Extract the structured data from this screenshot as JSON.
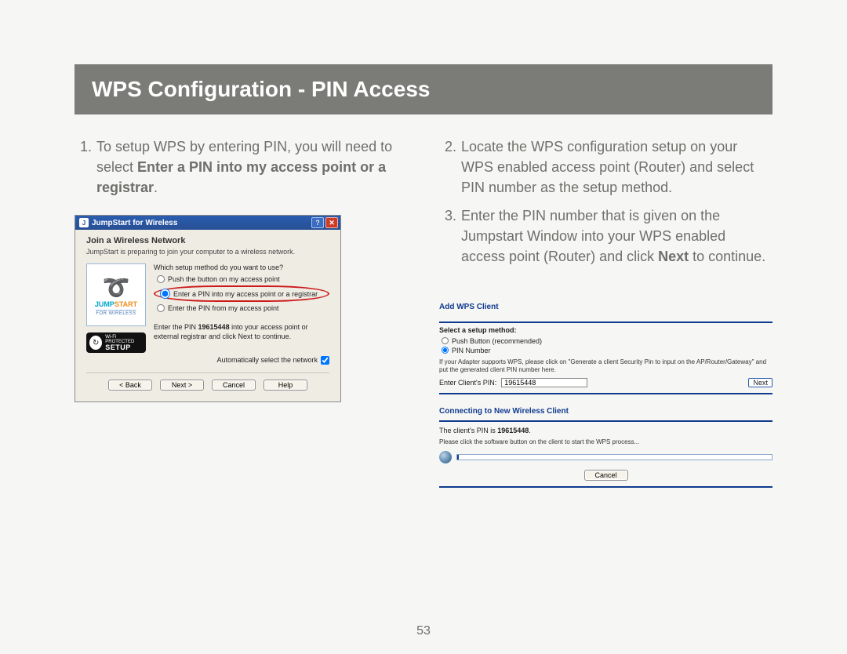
{
  "title": "WPS Configuration - PIN Access",
  "page_number": "53",
  "steps_left": {
    "1": {
      "num": "1.",
      "pre": "To setup WPS by entering PIN, you will need to select ",
      "bold": "Enter a PIN into my access point or a registrar",
      "post": "."
    }
  },
  "steps_right": {
    "2": {
      "num": "2.",
      "text": "Locate the WPS configuration setup on your WPS enabled access point (Router) and select PIN number as the setup method."
    },
    "3": {
      "num": "3.",
      "pre": "Enter the PIN number that is given on the Jumpstart Window into your WPS enabled access point (Router) and click ",
      "bold": "Next",
      "post": " to continue."
    }
  },
  "dialog": {
    "app_icon_glyph": "J",
    "title": "JumpStart for Wireless",
    "help_glyph": "?",
    "close_glyph": "✕",
    "heading": "Join a Wireless Network",
    "subheading": "JumpStart is preparing to join your computer to a wireless network.",
    "logo_word_a": "JUMP",
    "logo_word_b": "START",
    "logo_sub": "FOR WIRELESS",
    "wps_top": "Wi-Fi PROTECTED",
    "wps_setup": "SETUP",
    "question": "Which setup method do you want to use?",
    "opt1": "Push the button on my access point",
    "opt2": "Enter a PIN into my access point or a registrar",
    "opt3": "Enter the PIN from my access point",
    "enter_pin_a": "Enter the PIN ",
    "enter_pin_b": "19615448",
    "enter_pin_c": " into your access point or external registrar and click Next to continue.",
    "auto": "Automatically select the network",
    "buttons": {
      "back": "< Back",
      "next": "Next >",
      "cancel": "Cancel",
      "help": "Help"
    }
  },
  "router_a": {
    "heading": "Add WPS Client",
    "select": "Select a setup method:",
    "opt1": "Push Button (recommended)",
    "opt2": "PIN Number",
    "note": "If your Adapter supports WPS, please click on \"Generate a client Security Pin to input on the AP/Router/Gateway\" and put the generated client PIN number here.",
    "enter_label": "Enter Client's PIN:",
    "pin_value": "19615448",
    "next": "Next"
  },
  "router_b": {
    "heading": "Connecting to New Wireless Client",
    "line": "The client's PIN is ",
    "pin": "19615448",
    "dot": ".",
    "instr": "Please click the software button on the client to start the WPS process...",
    "cancel": "Cancel"
  }
}
